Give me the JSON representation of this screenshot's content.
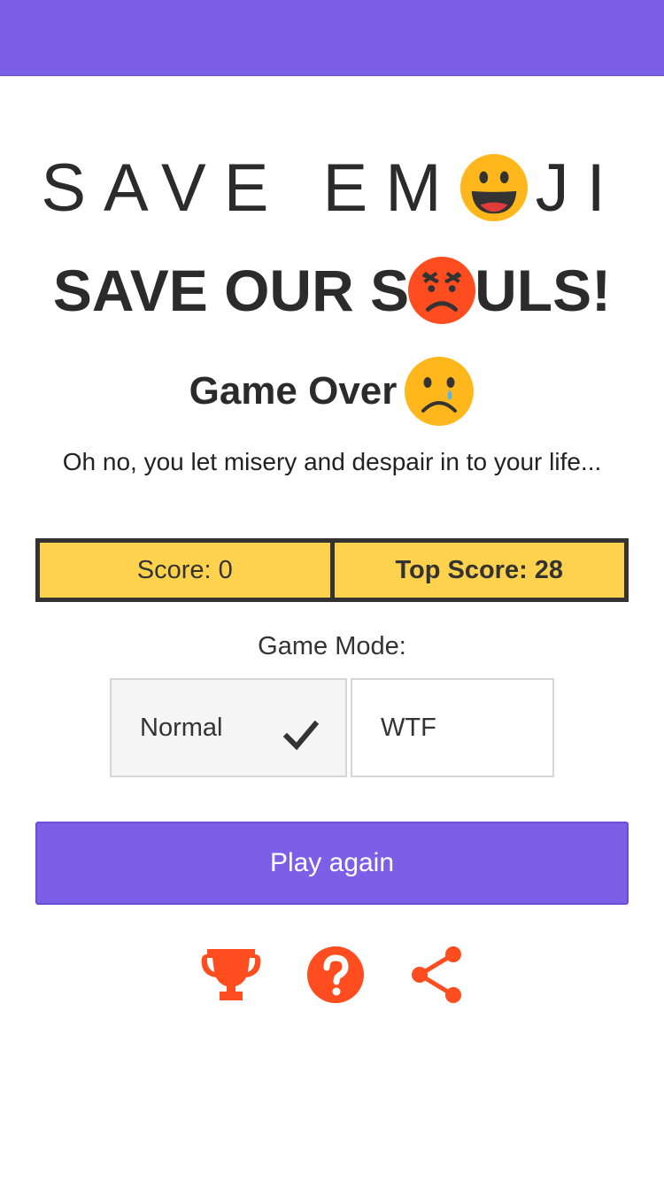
{
  "header": {
    "color": "#7b5fe6"
  },
  "title": {
    "line1_before": "SAVE EM",
    "line1_emoji": "grinning-face-emoji",
    "line1_after": "JI",
    "line2_before": "SAVE OUR S",
    "line2_emoji": "angry-face-emoji",
    "line2_after": "ULS!"
  },
  "game_over": {
    "heading": "Game Over",
    "emoji": "crying-face-emoji",
    "message": "Oh no, you let misery and despair in to your life..."
  },
  "score": {
    "current_label": "Score: 0",
    "top_label": "Top Score: 28",
    "background": "#ffd24d"
  },
  "game_mode": {
    "label": "Game Mode:",
    "options": [
      {
        "label": "Normal",
        "selected": true
      },
      {
        "label": "WTF",
        "selected": false
      }
    ]
  },
  "actions": {
    "play_again": "Play again",
    "icons": [
      "trophy-icon",
      "help-icon",
      "share-icon"
    ],
    "icon_color": "#ff4d1f"
  }
}
